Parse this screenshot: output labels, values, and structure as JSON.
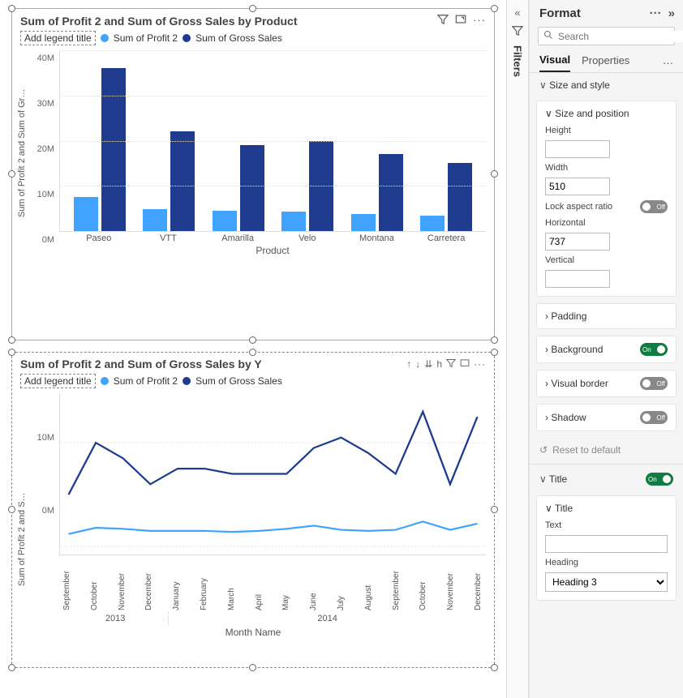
{
  "chart_data": [
    {
      "type": "bar",
      "title": "Sum of Profit 2 and Sum of Gross Sales by Product",
      "xlabel": "Product",
      "ylabel": "Sum of Profit 2 and Sum of Gr…",
      "ylim": [
        0,
        40000000
      ],
      "yticks": [
        "40M",
        "30M",
        "20M",
        "10M",
        "0M"
      ],
      "categories": [
        "Paseo",
        "VTT",
        "Amarilla",
        "Velo",
        "Montana",
        "Carretera"
      ],
      "series": [
        {
          "name": "Sum of Profit 2",
          "color": "#40a3ff",
          "values": [
            7500000,
            4900000,
            4400000,
            4300000,
            3800000,
            3500000
          ]
        },
        {
          "name": "Sum of Gross Sales",
          "color": "#1f3b8e",
          "values": [
            36000000,
            22000000,
            19000000,
            20000000,
            17000000,
            15000000
          ]
        }
      ],
      "legend_title_placeholder": "Add legend title"
    },
    {
      "type": "line",
      "title": "Sum of Profit 2 and Sum of Gross Sales by Y",
      "xlabel": "Month Name",
      "ylabel": "Sum of Profit 2 and S…",
      "yticks": [
        "10M",
        "0M"
      ],
      "ylim": [
        0,
        14000000
      ],
      "x": [
        "September",
        "October",
        "November",
        "December",
        "January",
        "February",
        "March",
        "April",
        "May",
        "June",
        "July",
        "August",
        "September",
        "October",
        "November",
        "December"
      ],
      "year_groups": [
        {
          "label": "2013",
          "span": 4
        },
        {
          "label": "2014",
          "span": 12
        }
      ],
      "series": [
        {
          "name": "Sum of Profit 2",
          "color": "#40a3ff",
          "values": [
            1200000,
            1800000,
            1700000,
            1500000,
            1500000,
            1500000,
            1400000,
            1500000,
            1700000,
            2000000,
            1600000,
            1500000,
            1600000,
            2400000,
            1600000,
            2200000
          ]
        },
        {
          "name": "Sum of Gross Sales",
          "color": "#1f3b8e",
          "values": [
            5000000,
            10000000,
            8500000,
            6000000,
            7500000,
            7500000,
            7000000,
            7000000,
            7000000,
            9500000,
            10500000,
            9000000,
            7000000,
            13000000,
            6000000,
            12500000
          ]
        }
      ],
      "legend_title_placeholder": "Add legend title"
    }
  ],
  "colors": {
    "series1": "#40a3ff",
    "series2": "#1f3b8e"
  },
  "filters_pane": {
    "label": "Filters"
  },
  "format_pane": {
    "header": "Format",
    "search_placeholder": "Search",
    "tabs": {
      "visual": "Visual",
      "properties": "Properties"
    },
    "size_style": "Size and style",
    "sections": {
      "size_position": {
        "title": "Size and position",
        "height_label": "Height",
        "height_value": "",
        "width_label": "Width",
        "width_value": "510",
        "lock_label": "Lock aspect ratio",
        "lock_state": "Off",
        "horizontal_label": "Horizontal",
        "horizontal_value": "737",
        "vertical_label": "Vertical",
        "vertical_value": ""
      },
      "padding": {
        "title": "Padding"
      },
      "background": {
        "title": "Background",
        "state": "On"
      },
      "visual_border": {
        "title": "Visual border",
        "state": "Off"
      },
      "shadow": {
        "title": "Shadow",
        "state": "Off"
      }
    },
    "reset": "Reset to default",
    "title_section": {
      "title": "Title",
      "state": "On",
      "sub_title": "Title",
      "text_label": "Text",
      "text_value": "",
      "heading_label": "Heading",
      "heading_value": "Heading 3"
    }
  }
}
